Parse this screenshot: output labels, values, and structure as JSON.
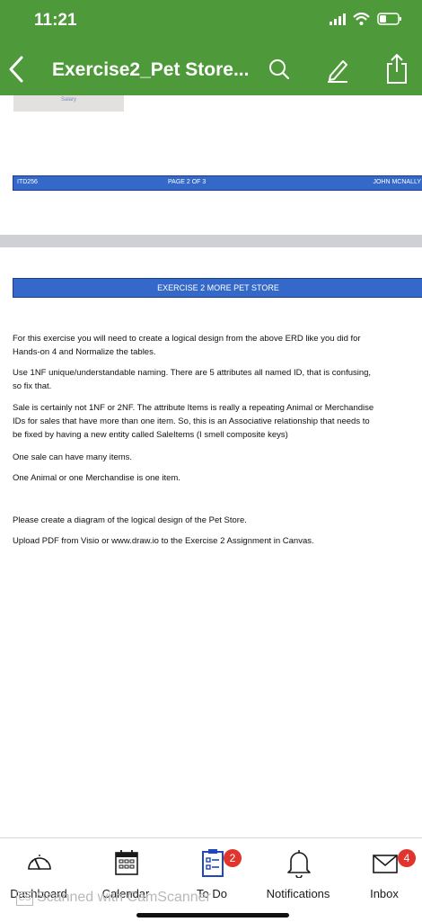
{
  "status": {
    "time": "11:21"
  },
  "header": {
    "title": "Exercise2_Pet Store..."
  },
  "icons": {
    "back": "chevron-left-icon",
    "search": "search-icon",
    "annotate": "pen-icon",
    "share": "share-icon"
  },
  "document": {
    "thumb_label": "Salary",
    "page_footer": {
      "left": "ITD256",
      "center": "PAGE 2 OF 3",
      "right": "JOHN MCNALLY"
    },
    "section_title": "EXERCISE 2 MORE PET STORE",
    "paragraphs": [
      "For this exercise you will need to create a logical design from the above ERD like you did for\nHands-on 4 and Normalize the tables.",
      "Use 1NF unique/understandable naming.  There are 5 attributes all named ID, that is confusing,\nso fix that.",
      "Sale is certainly not 1NF or 2NF. The attribute Items is really a repeating Animal or Merchandise\nIDs for sales that have more than one item.   So, this is an Associative relationship that needs to\nbe fixed by having a new entity called SaleItems (I smell composite keys)",
      "One sale can have many items.",
      "One Animal or one Merchandise is one item.",
      "Please create a diagram of the logical design of the Pet Store.",
      "Upload PDF from Visio or www.draw.io to the Exercise 2 Assignment in Canvas."
    ]
  },
  "tabbar": {
    "tabs": [
      {
        "label": "Dashboard",
        "icon": "dashboard-icon"
      },
      {
        "label": "Calendar",
        "icon": "calendar-icon"
      },
      {
        "label": "To Do",
        "icon": "todo-icon",
        "badge": "2"
      },
      {
        "label": "Notifications",
        "icon": "bell-icon"
      },
      {
        "label": "Inbox",
        "icon": "mail-icon",
        "badge": "4"
      }
    ]
  },
  "watermark": {
    "logo": "CS",
    "text": "Scanned with CamScanner"
  },
  "colors": {
    "header_bg": "#4e9a3a",
    "doc_bar": "#3569c9",
    "accent": "#1f48c0",
    "badge": "#e0342c"
  }
}
